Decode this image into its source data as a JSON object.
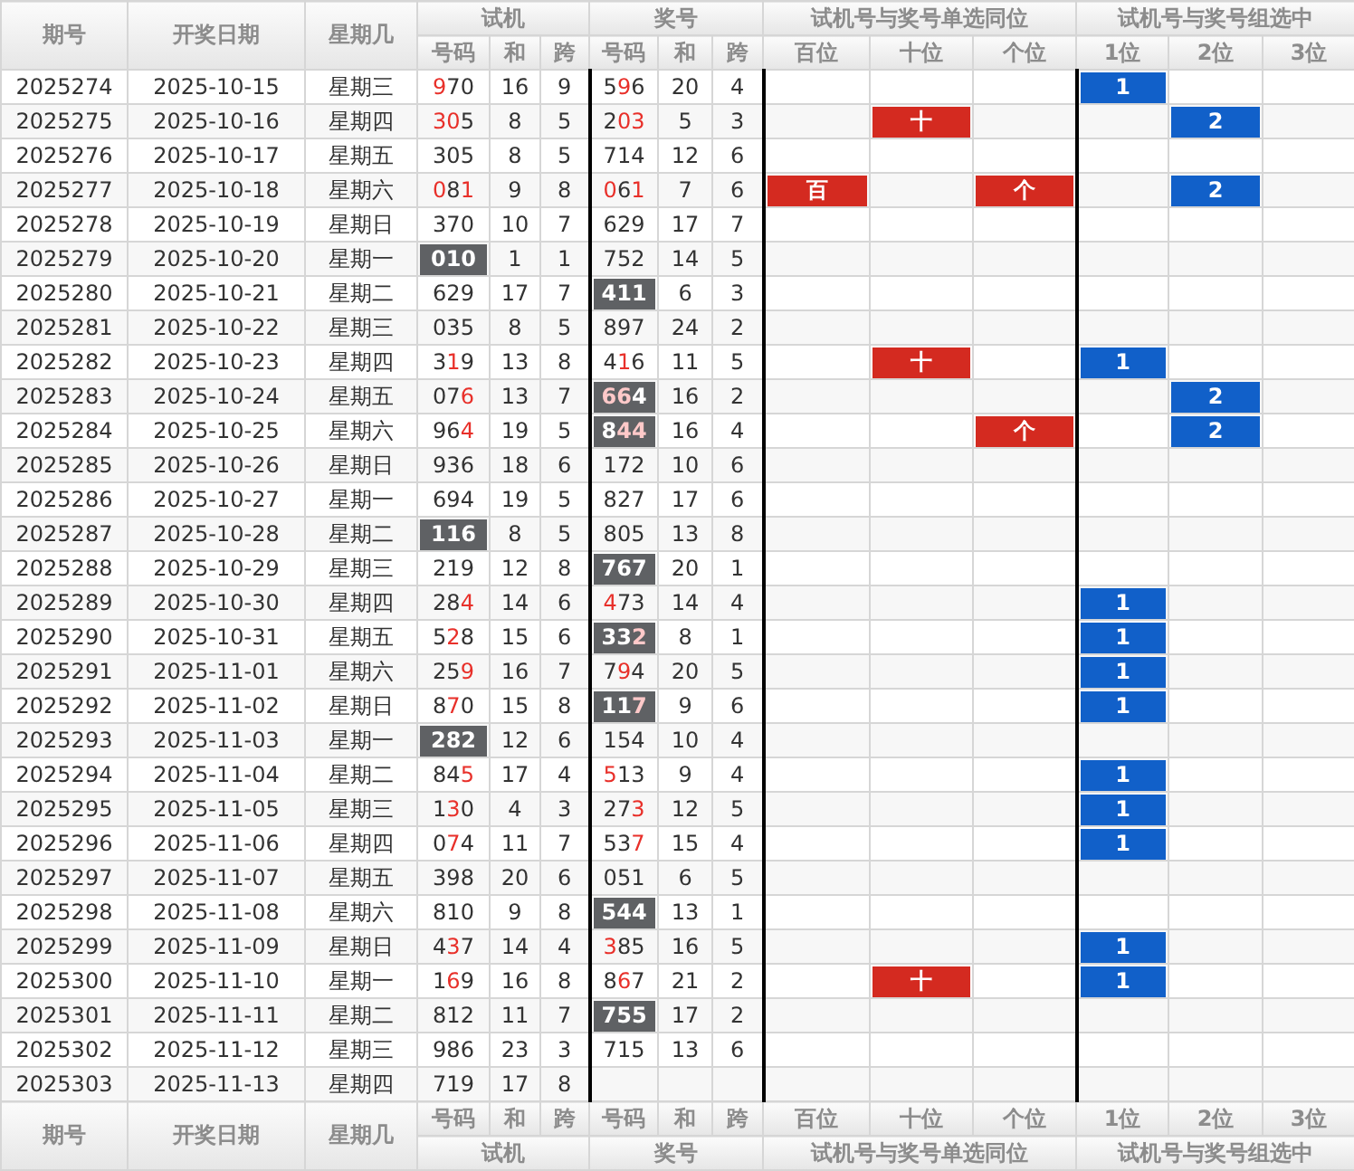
{
  "header": {
    "fixed": [
      "期号",
      "开奖日期",
      "星期几"
    ],
    "groups": [
      {
        "label": "试机",
        "subcolumns": [
          "号码",
          "和",
          "跨"
        ]
      },
      {
        "label": "奖号",
        "subcolumns": [
          "号码",
          "和",
          "跨"
        ]
      },
      {
        "label": "试机号与奖号单选同位",
        "subcolumns": [
          "百位",
          "十位",
          "个位"
        ]
      },
      {
        "label": "试机号与奖号组选中",
        "subcolumns": [
          "1位",
          "2位",
          "3位"
        ]
      }
    ]
  },
  "rows": [
    {
      "period": "2025274",
      "date": "2025-10-15",
      "weekday": "星期三",
      "trial": {
        "number": "970",
        "red": [
          true,
          false,
          false
        ],
        "boxed": false,
        "sum": "16",
        "span": "9"
      },
      "draw": {
        "number": "596",
        "red": [
          false,
          true,
          false
        ],
        "boxed": false,
        "sum": "20",
        "span": "4"
      },
      "same_position": [
        {
          "hit": false
        },
        {
          "hit": false
        },
        {
          "hit": false
        }
      ],
      "group": [
        {
          "hit": true,
          "text": "1"
        },
        {
          "hit": false
        },
        {
          "hit": false
        }
      ]
    },
    {
      "period": "2025275",
      "date": "2025-10-16",
      "weekday": "星期四",
      "trial": {
        "number": "305",
        "red": [
          true,
          true,
          false
        ],
        "boxed": false,
        "sum": "8",
        "span": "5"
      },
      "draw": {
        "number": "203",
        "red": [
          false,
          true,
          true
        ],
        "boxed": false,
        "sum": "5",
        "span": "3"
      },
      "same_position": [
        {
          "hit": false
        },
        {
          "hit": true,
          "text": "十"
        },
        {
          "hit": false
        }
      ],
      "group": [
        {
          "hit": false
        },
        {
          "hit": true,
          "text": "2"
        },
        {
          "hit": false
        }
      ]
    },
    {
      "period": "2025276",
      "date": "2025-10-17",
      "weekday": "星期五",
      "trial": {
        "number": "305",
        "red": [
          false,
          false,
          false
        ],
        "boxed": false,
        "sum": "8",
        "span": "5"
      },
      "draw": {
        "number": "714",
        "red": [
          false,
          false,
          false
        ],
        "boxed": false,
        "sum": "12",
        "span": "6"
      },
      "same_position": [
        {
          "hit": false
        },
        {
          "hit": false
        },
        {
          "hit": false
        }
      ],
      "group": [
        {
          "hit": false
        },
        {
          "hit": false
        },
        {
          "hit": false
        }
      ]
    },
    {
      "period": "2025277",
      "date": "2025-10-18",
      "weekday": "星期六",
      "trial": {
        "number": "081",
        "red": [
          true,
          false,
          true
        ],
        "boxed": false,
        "sum": "9",
        "span": "8"
      },
      "draw": {
        "number": "061",
        "red": [
          true,
          false,
          true
        ],
        "boxed": false,
        "sum": "7",
        "span": "6"
      },
      "same_position": [
        {
          "hit": true,
          "text": "百"
        },
        {
          "hit": false
        },
        {
          "hit": true,
          "text": "个"
        }
      ],
      "group": [
        {
          "hit": false
        },
        {
          "hit": true,
          "text": "2"
        },
        {
          "hit": false
        }
      ]
    },
    {
      "period": "2025278",
      "date": "2025-10-19",
      "weekday": "星期日",
      "trial": {
        "number": "370",
        "red": [
          false,
          false,
          false
        ],
        "boxed": false,
        "sum": "10",
        "span": "7"
      },
      "draw": {
        "number": "629",
        "red": [
          false,
          false,
          false
        ],
        "boxed": false,
        "sum": "17",
        "span": "7"
      },
      "same_position": [
        {
          "hit": false
        },
        {
          "hit": false
        },
        {
          "hit": false
        }
      ],
      "group": [
        {
          "hit": false
        },
        {
          "hit": false
        },
        {
          "hit": false
        }
      ]
    },
    {
      "period": "2025279",
      "date": "2025-10-20",
      "weekday": "星期一",
      "trial": {
        "number": "010",
        "red": [
          false,
          false,
          false
        ],
        "boxed": true,
        "sum": "1",
        "span": "1"
      },
      "draw": {
        "number": "752",
        "red": [
          false,
          false,
          false
        ],
        "boxed": false,
        "sum": "14",
        "span": "5"
      },
      "same_position": [
        {
          "hit": false
        },
        {
          "hit": false
        },
        {
          "hit": false
        }
      ],
      "group": [
        {
          "hit": false
        },
        {
          "hit": false
        },
        {
          "hit": false
        }
      ]
    },
    {
      "period": "2025280",
      "date": "2025-10-21",
      "weekday": "星期二",
      "trial": {
        "number": "629",
        "red": [
          false,
          false,
          false
        ],
        "boxed": false,
        "sum": "17",
        "span": "7"
      },
      "draw": {
        "number": "411",
        "red": [
          false,
          false,
          false
        ],
        "boxed": true,
        "sum": "6",
        "span": "3"
      },
      "same_position": [
        {
          "hit": false
        },
        {
          "hit": false
        },
        {
          "hit": false
        }
      ],
      "group": [
        {
          "hit": false
        },
        {
          "hit": false
        },
        {
          "hit": false
        }
      ]
    },
    {
      "period": "2025281",
      "date": "2025-10-22",
      "weekday": "星期三",
      "trial": {
        "number": "035",
        "red": [
          false,
          false,
          false
        ],
        "boxed": false,
        "sum": "8",
        "span": "5"
      },
      "draw": {
        "number": "897",
        "red": [
          false,
          false,
          false
        ],
        "boxed": false,
        "sum": "24",
        "span": "2"
      },
      "same_position": [
        {
          "hit": false
        },
        {
          "hit": false
        },
        {
          "hit": false
        }
      ],
      "group": [
        {
          "hit": false
        },
        {
          "hit": false
        },
        {
          "hit": false
        }
      ]
    },
    {
      "period": "2025282",
      "date": "2025-10-23",
      "weekday": "星期四",
      "trial": {
        "number": "319",
        "red": [
          false,
          true,
          false
        ],
        "boxed": false,
        "sum": "13",
        "span": "8"
      },
      "draw": {
        "number": "416",
        "red": [
          false,
          true,
          false
        ],
        "boxed": false,
        "sum": "11",
        "span": "5"
      },
      "same_position": [
        {
          "hit": false
        },
        {
          "hit": true,
          "text": "十"
        },
        {
          "hit": false
        }
      ],
      "group": [
        {
          "hit": true,
          "text": "1"
        },
        {
          "hit": false
        },
        {
          "hit": false
        }
      ]
    },
    {
      "period": "2025283",
      "date": "2025-10-24",
      "weekday": "星期五",
      "trial": {
        "number": "076",
        "red": [
          false,
          false,
          true
        ],
        "boxed": false,
        "sum": "13",
        "span": "7"
      },
      "draw": {
        "number": "664",
        "red": [
          true,
          true,
          false
        ],
        "boxed": true,
        "sum": "16",
        "span": "2"
      },
      "same_position": [
        {
          "hit": false
        },
        {
          "hit": false
        },
        {
          "hit": false
        }
      ],
      "group": [
        {
          "hit": false
        },
        {
          "hit": true,
          "text": "2"
        },
        {
          "hit": false
        }
      ]
    },
    {
      "period": "2025284",
      "date": "2025-10-25",
      "weekday": "星期六",
      "trial": {
        "number": "964",
        "red": [
          false,
          false,
          true
        ],
        "boxed": false,
        "sum": "19",
        "span": "5"
      },
      "draw": {
        "number": "844",
        "red": [
          false,
          true,
          true
        ],
        "boxed": true,
        "sum": "16",
        "span": "4"
      },
      "same_position": [
        {
          "hit": false
        },
        {
          "hit": false
        },
        {
          "hit": true,
          "text": "个"
        }
      ],
      "group": [
        {
          "hit": false
        },
        {
          "hit": true,
          "text": "2"
        },
        {
          "hit": false
        }
      ]
    },
    {
      "period": "2025285",
      "date": "2025-10-26",
      "weekday": "星期日",
      "trial": {
        "number": "936",
        "red": [
          false,
          false,
          false
        ],
        "boxed": false,
        "sum": "18",
        "span": "6"
      },
      "draw": {
        "number": "172",
        "red": [
          false,
          false,
          false
        ],
        "boxed": false,
        "sum": "10",
        "span": "6"
      },
      "same_position": [
        {
          "hit": false
        },
        {
          "hit": false
        },
        {
          "hit": false
        }
      ],
      "group": [
        {
          "hit": false
        },
        {
          "hit": false
        },
        {
          "hit": false
        }
      ]
    },
    {
      "period": "2025286",
      "date": "2025-10-27",
      "weekday": "星期一",
      "trial": {
        "number": "694",
        "red": [
          false,
          false,
          false
        ],
        "boxed": false,
        "sum": "19",
        "span": "5"
      },
      "draw": {
        "number": "827",
        "red": [
          false,
          false,
          false
        ],
        "boxed": false,
        "sum": "17",
        "span": "6"
      },
      "same_position": [
        {
          "hit": false
        },
        {
          "hit": false
        },
        {
          "hit": false
        }
      ],
      "group": [
        {
          "hit": false
        },
        {
          "hit": false
        },
        {
          "hit": false
        }
      ]
    },
    {
      "period": "2025287",
      "date": "2025-10-28",
      "weekday": "星期二",
      "trial": {
        "number": "116",
        "red": [
          false,
          false,
          false
        ],
        "boxed": true,
        "sum": "8",
        "span": "5"
      },
      "draw": {
        "number": "805",
        "red": [
          false,
          false,
          false
        ],
        "boxed": false,
        "sum": "13",
        "span": "8"
      },
      "same_position": [
        {
          "hit": false
        },
        {
          "hit": false
        },
        {
          "hit": false
        }
      ],
      "group": [
        {
          "hit": false
        },
        {
          "hit": false
        },
        {
          "hit": false
        }
      ]
    },
    {
      "period": "2025288",
      "date": "2025-10-29",
      "weekday": "星期三",
      "trial": {
        "number": "219",
        "red": [
          false,
          false,
          false
        ],
        "boxed": false,
        "sum": "12",
        "span": "8"
      },
      "draw": {
        "number": "767",
        "red": [
          false,
          false,
          false
        ],
        "boxed": true,
        "sum": "20",
        "span": "1"
      },
      "same_position": [
        {
          "hit": false
        },
        {
          "hit": false
        },
        {
          "hit": false
        }
      ],
      "group": [
        {
          "hit": false
        },
        {
          "hit": false
        },
        {
          "hit": false
        }
      ]
    },
    {
      "period": "2025289",
      "date": "2025-10-30",
      "weekday": "星期四",
      "trial": {
        "number": "284",
        "red": [
          false,
          false,
          true
        ],
        "boxed": false,
        "sum": "14",
        "span": "6"
      },
      "draw": {
        "number": "473",
        "red": [
          true,
          false,
          false
        ],
        "boxed": false,
        "sum": "14",
        "span": "4"
      },
      "same_position": [
        {
          "hit": false
        },
        {
          "hit": false
        },
        {
          "hit": false
        }
      ],
      "group": [
        {
          "hit": true,
          "text": "1"
        },
        {
          "hit": false
        },
        {
          "hit": false
        }
      ]
    },
    {
      "period": "2025290",
      "date": "2025-10-31",
      "weekday": "星期五",
      "trial": {
        "number": "528",
        "red": [
          false,
          true,
          false
        ],
        "boxed": false,
        "sum": "15",
        "span": "6"
      },
      "draw": {
        "number": "332",
        "red": [
          false,
          false,
          true
        ],
        "boxed": true,
        "sum": "8",
        "span": "1"
      },
      "same_position": [
        {
          "hit": false
        },
        {
          "hit": false
        },
        {
          "hit": false
        }
      ],
      "group": [
        {
          "hit": true,
          "text": "1"
        },
        {
          "hit": false
        },
        {
          "hit": false
        }
      ]
    },
    {
      "period": "2025291",
      "date": "2025-11-01",
      "weekday": "星期六",
      "trial": {
        "number": "259",
        "red": [
          false,
          false,
          true
        ],
        "boxed": false,
        "sum": "16",
        "span": "7"
      },
      "draw": {
        "number": "794",
        "red": [
          false,
          true,
          false
        ],
        "boxed": false,
        "sum": "20",
        "span": "5"
      },
      "same_position": [
        {
          "hit": false
        },
        {
          "hit": false
        },
        {
          "hit": false
        }
      ],
      "group": [
        {
          "hit": true,
          "text": "1"
        },
        {
          "hit": false
        },
        {
          "hit": false
        }
      ]
    },
    {
      "period": "2025292",
      "date": "2025-11-02",
      "weekday": "星期日",
      "trial": {
        "number": "870",
        "red": [
          false,
          true,
          false
        ],
        "boxed": false,
        "sum": "15",
        "span": "8"
      },
      "draw": {
        "number": "117",
        "red": [
          false,
          false,
          true
        ],
        "boxed": true,
        "sum": "9",
        "span": "6"
      },
      "same_position": [
        {
          "hit": false
        },
        {
          "hit": false
        },
        {
          "hit": false
        }
      ],
      "group": [
        {
          "hit": true,
          "text": "1"
        },
        {
          "hit": false
        },
        {
          "hit": false
        }
      ]
    },
    {
      "period": "2025293",
      "date": "2025-11-03",
      "weekday": "星期一",
      "trial": {
        "number": "282",
        "red": [
          false,
          false,
          false
        ],
        "boxed": true,
        "sum": "12",
        "span": "6"
      },
      "draw": {
        "number": "154",
        "red": [
          false,
          false,
          false
        ],
        "boxed": false,
        "sum": "10",
        "span": "4"
      },
      "same_position": [
        {
          "hit": false
        },
        {
          "hit": false
        },
        {
          "hit": false
        }
      ],
      "group": [
        {
          "hit": false
        },
        {
          "hit": false
        },
        {
          "hit": false
        }
      ]
    },
    {
      "period": "2025294",
      "date": "2025-11-04",
      "weekday": "星期二",
      "trial": {
        "number": "845",
        "red": [
          false,
          false,
          true
        ],
        "boxed": false,
        "sum": "17",
        "span": "4"
      },
      "draw": {
        "number": "513",
        "red": [
          true,
          false,
          false
        ],
        "boxed": false,
        "sum": "9",
        "span": "4"
      },
      "same_position": [
        {
          "hit": false
        },
        {
          "hit": false
        },
        {
          "hit": false
        }
      ],
      "group": [
        {
          "hit": true,
          "text": "1"
        },
        {
          "hit": false
        },
        {
          "hit": false
        }
      ]
    },
    {
      "period": "2025295",
      "date": "2025-11-05",
      "weekday": "星期三",
      "trial": {
        "number": "130",
        "red": [
          false,
          true,
          false
        ],
        "boxed": false,
        "sum": "4",
        "span": "3"
      },
      "draw": {
        "number": "273",
        "red": [
          false,
          false,
          true
        ],
        "boxed": false,
        "sum": "12",
        "span": "5"
      },
      "same_position": [
        {
          "hit": false
        },
        {
          "hit": false
        },
        {
          "hit": false
        }
      ],
      "group": [
        {
          "hit": true,
          "text": "1"
        },
        {
          "hit": false
        },
        {
          "hit": false
        }
      ]
    },
    {
      "period": "2025296",
      "date": "2025-11-06",
      "weekday": "星期四",
      "trial": {
        "number": "074",
        "red": [
          false,
          true,
          false
        ],
        "boxed": false,
        "sum": "11",
        "span": "7"
      },
      "draw": {
        "number": "537",
        "red": [
          false,
          false,
          true
        ],
        "boxed": false,
        "sum": "15",
        "span": "4"
      },
      "same_position": [
        {
          "hit": false
        },
        {
          "hit": false
        },
        {
          "hit": false
        }
      ],
      "group": [
        {
          "hit": true,
          "text": "1"
        },
        {
          "hit": false
        },
        {
          "hit": false
        }
      ]
    },
    {
      "period": "2025297",
      "date": "2025-11-07",
      "weekday": "星期五",
      "trial": {
        "number": "398",
        "red": [
          false,
          false,
          false
        ],
        "boxed": false,
        "sum": "20",
        "span": "6"
      },
      "draw": {
        "number": "051",
        "red": [
          false,
          false,
          false
        ],
        "boxed": false,
        "sum": "6",
        "span": "5"
      },
      "same_position": [
        {
          "hit": false
        },
        {
          "hit": false
        },
        {
          "hit": false
        }
      ],
      "group": [
        {
          "hit": false
        },
        {
          "hit": false
        },
        {
          "hit": false
        }
      ]
    },
    {
      "period": "2025298",
      "date": "2025-11-08",
      "weekday": "星期六",
      "trial": {
        "number": "810",
        "red": [
          false,
          false,
          false
        ],
        "boxed": false,
        "sum": "9",
        "span": "8"
      },
      "draw": {
        "number": "544",
        "red": [
          false,
          false,
          false
        ],
        "boxed": true,
        "sum": "13",
        "span": "1"
      },
      "same_position": [
        {
          "hit": false
        },
        {
          "hit": false
        },
        {
          "hit": false
        }
      ],
      "group": [
        {
          "hit": false
        },
        {
          "hit": false
        },
        {
          "hit": false
        }
      ]
    },
    {
      "period": "2025299",
      "date": "2025-11-09",
      "weekday": "星期日",
      "trial": {
        "number": "437",
        "red": [
          false,
          true,
          false
        ],
        "boxed": false,
        "sum": "14",
        "span": "4"
      },
      "draw": {
        "number": "385",
        "red": [
          true,
          false,
          false
        ],
        "boxed": false,
        "sum": "16",
        "span": "5"
      },
      "same_position": [
        {
          "hit": false
        },
        {
          "hit": false
        },
        {
          "hit": false
        }
      ],
      "group": [
        {
          "hit": true,
          "text": "1"
        },
        {
          "hit": false
        },
        {
          "hit": false
        }
      ]
    },
    {
      "period": "2025300",
      "date": "2025-11-10",
      "weekday": "星期一",
      "trial": {
        "number": "169",
        "red": [
          false,
          true,
          false
        ],
        "boxed": false,
        "sum": "16",
        "span": "8"
      },
      "draw": {
        "number": "867",
        "red": [
          false,
          true,
          false
        ],
        "boxed": false,
        "sum": "21",
        "span": "2"
      },
      "same_position": [
        {
          "hit": false
        },
        {
          "hit": true,
          "text": "十"
        },
        {
          "hit": false
        }
      ],
      "group": [
        {
          "hit": true,
          "text": "1"
        },
        {
          "hit": false
        },
        {
          "hit": false
        }
      ]
    },
    {
      "period": "2025301",
      "date": "2025-11-11",
      "weekday": "星期二",
      "trial": {
        "number": "812",
        "red": [
          false,
          false,
          false
        ],
        "boxed": false,
        "sum": "11",
        "span": "7"
      },
      "draw": {
        "number": "755",
        "red": [
          false,
          false,
          false
        ],
        "boxed": true,
        "sum": "17",
        "span": "2"
      },
      "same_position": [
        {
          "hit": false
        },
        {
          "hit": false
        },
        {
          "hit": false
        }
      ],
      "group": [
        {
          "hit": false
        },
        {
          "hit": false
        },
        {
          "hit": false
        }
      ]
    },
    {
      "period": "2025302",
      "date": "2025-11-12",
      "weekday": "星期三",
      "trial": {
        "number": "986",
        "red": [
          false,
          false,
          false
        ],
        "boxed": false,
        "sum": "23",
        "span": "3"
      },
      "draw": {
        "number": "715",
        "red": [
          false,
          false,
          false
        ],
        "boxed": false,
        "sum": "13",
        "span": "6"
      },
      "same_position": [
        {
          "hit": false
        },
        {
          "hit": false
        },
        {
          "hit": false
        }
      ],
      "group": [
        {
          "hit": false
        },
        {
          "hit": false
        },
        {
          "hit": false
        }
      ]
    },
    {
      "period": "2025303",
      "date": "2025-11-13",
      "weekday": "星期四",
      "trial": {
        "number": "719",
        "red": [
          false,
          false,
          false
        ],
        "boxed": false,
        "sum": "17",
        "span": "8"
      },
      "same_position": [
        {
          "hit": false
        },
        {
          "hit": false
        },
        {
          "hit": false
        }
      ],
      "group": [
        {
          "hit": false
        },
        {
          "hit": false
        },
        {
          "hit": false
        }
      ]
    }
  ],
  "footer": {
    "fixed": [
      "期号",
      "开奖日期",
      "星期几"
    ],
    "groups": [
      {
        "label": "试机",
        "subcolumns": [
          "号码",
          "和",
          "跨"
        ]
      },
      {
        "label": "奖号",
        "subcolumns": [
          "号码",
          "和",
          "跨"
        ]
      },
      {
        "label": "试机号与奖号单选同位",
        "subcolumns": [
          "百位",
          "十位",
          "个位"
        ]
      },
      {
        "label": "试机号与奖号组选中",
        "subcolumns": [
          "1位",
          "2位",
          "3位"
        ]
      }
    ]
  }
}
